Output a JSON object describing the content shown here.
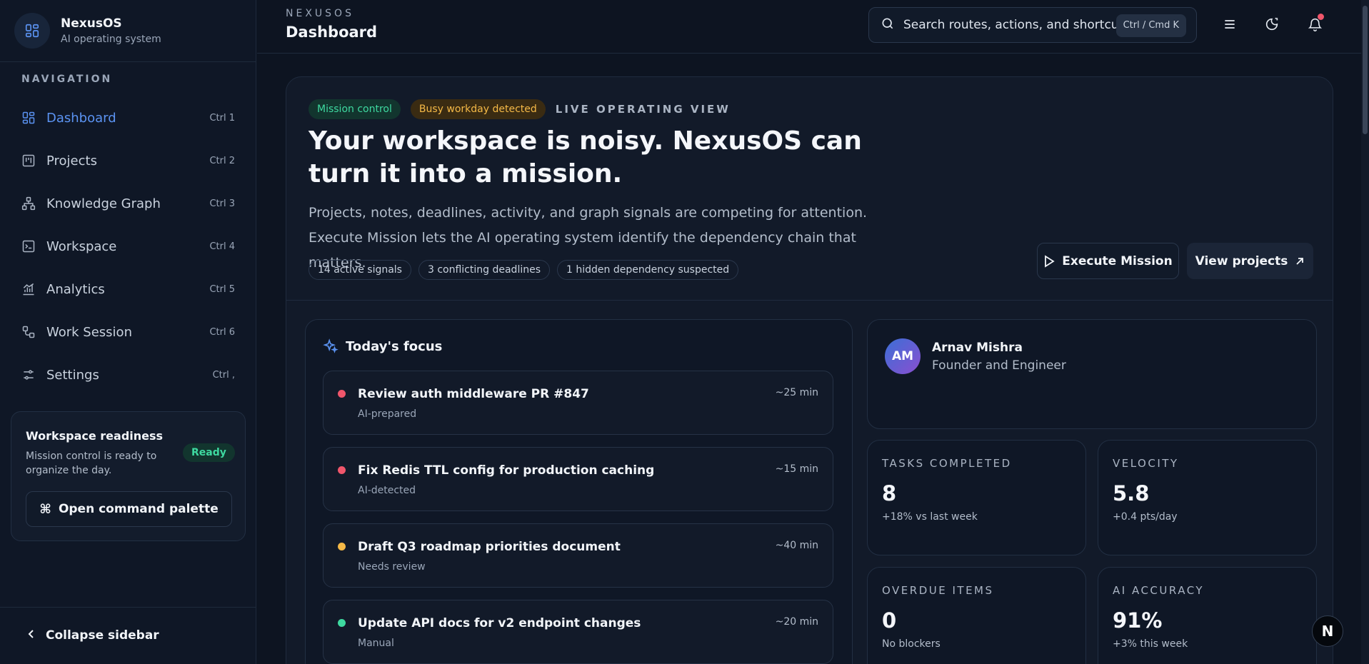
{
  "brand": {
    "name": "NexusOS",
    "subtitle": "AI operating system"
  },
  "nav": {
    "heading": "NAVIGATION",
    "items": [
      {
        "label": "Dashboard",
        "shortcut": "Ctrl 1",
        "icon": "dashboard-icon",
        "active": true
      },
      {
        "label": "Projects",
        "shortcut": "Ctrl 2",
        "icon": "kanban-icon"
      },
      {
        "label": "Knowledge Graph",
        "shortcut": "Ctrl 3",
        "icon": "graph-icon"
      },
      {
        "label": "Workspace",
        "shortcut": "Ctrl 4",
        "icon": "terminal-icon"
      },
      {
        "label": "Analytics",
        "shortcut": "Ctrl 5",
        "icon": "chart-icon"
      },
      {
        "label": "Work Session",
        "shortcut": "Ctrl 6",
        "icon": "workflow-icon"
      },
      {
        "label": "Settings",
        "shortcut": "Ctrl ,",
        "icon": "sliders-icon"
      }
    ]
  },
  "readiness": {
    "title": "Workspace readiness",
    "description": "Mission control is ready to organize the day.",
    "badge": "Ready",
    "command_label": "Open command palette"
  },
  "sidebar_footer": {
    "collapse_label": "Collapse sidebar"
  },
  "topbar": {
    "section": "NEXUSOS",
    "title": "Dashboard",
    "search_placeholder": "Search routes, actions, and shortcuts",
    "search_shortcut": "Ctrl / Cmd K"
  },
  "hero": {
    "tag_primary": "Mission control",
    "tag_warning": "Busy workday detected",
    "live_label": "LIVE OPERATING VIEW",
    "title": "Your workspace is noisy. NexusOS can turn it into a mission.",
    "description": "Projects, notes, deadlines, activity, and graph signals are competing for attention. Execute Mission lets the AI operating system identify the dependency chain that matters.",
    "chips": [
      "14 active signals",
      "3 conflicting deadlines",
      "1 hidden dependency suspected"
    ],
    "execute_label": "Execute Mission",
    "view_label": "View projects"
  },
  "focus": {
    "heading": "Today's focus",
    "tasks": [
      {
        "title": "Review auth middleware PR #847",
        "source": "AI-prepared",
        "time": "~25 min",
        "priority_color": "#f0566b"
      },
      {
        "title": "Fix Redis TTL config for production caching",
        "source": "AI-detected",
        "time": "~15 min",
        "priority_color": "#f0566b"
      },
      {
        "title": "Draft Q3 roadmap priorities document",
        "source": "Needs review",
        "time": "~40 min",
        "priority_color": "#f5b947"
      },
      {
        "title": "Update API docs for v2 endpoint changes",
        "source": "Manual",
        "time": "~20 min",
        "priority_color": "#3ed9a0"
      }
    ]
  },
  "profile": {
    "initials": "AM",
    "name": "Arnav Mishra",
    "role": "Founder and Engineer"
  },
  "stats": [
    {
      "label": "TASKS COMPLETED",
      "value": "8",
      "delta": "+18% vs last week"
    },
    {
      "label": "VELOCITY",
      "value": "5.8",
      "delta": "+0.4 pts/day"
    },
    {
      "label": "OVERDUE ITEMS",
      "value": "0",
      "delta": "No blockers"
    },
    {
      "label": "AI ACCURACY",
      "value": "91%",
      "delta": "+3% this week"
    }
  ],
  "assistant": {
    "glyph": "N"
  },
  "colors": {
    "accent": "#5b93f2",
    "success": "#3ed9a0",
    "warning": "#f5b947",
    "danger": "#f0566b"
  }
}
